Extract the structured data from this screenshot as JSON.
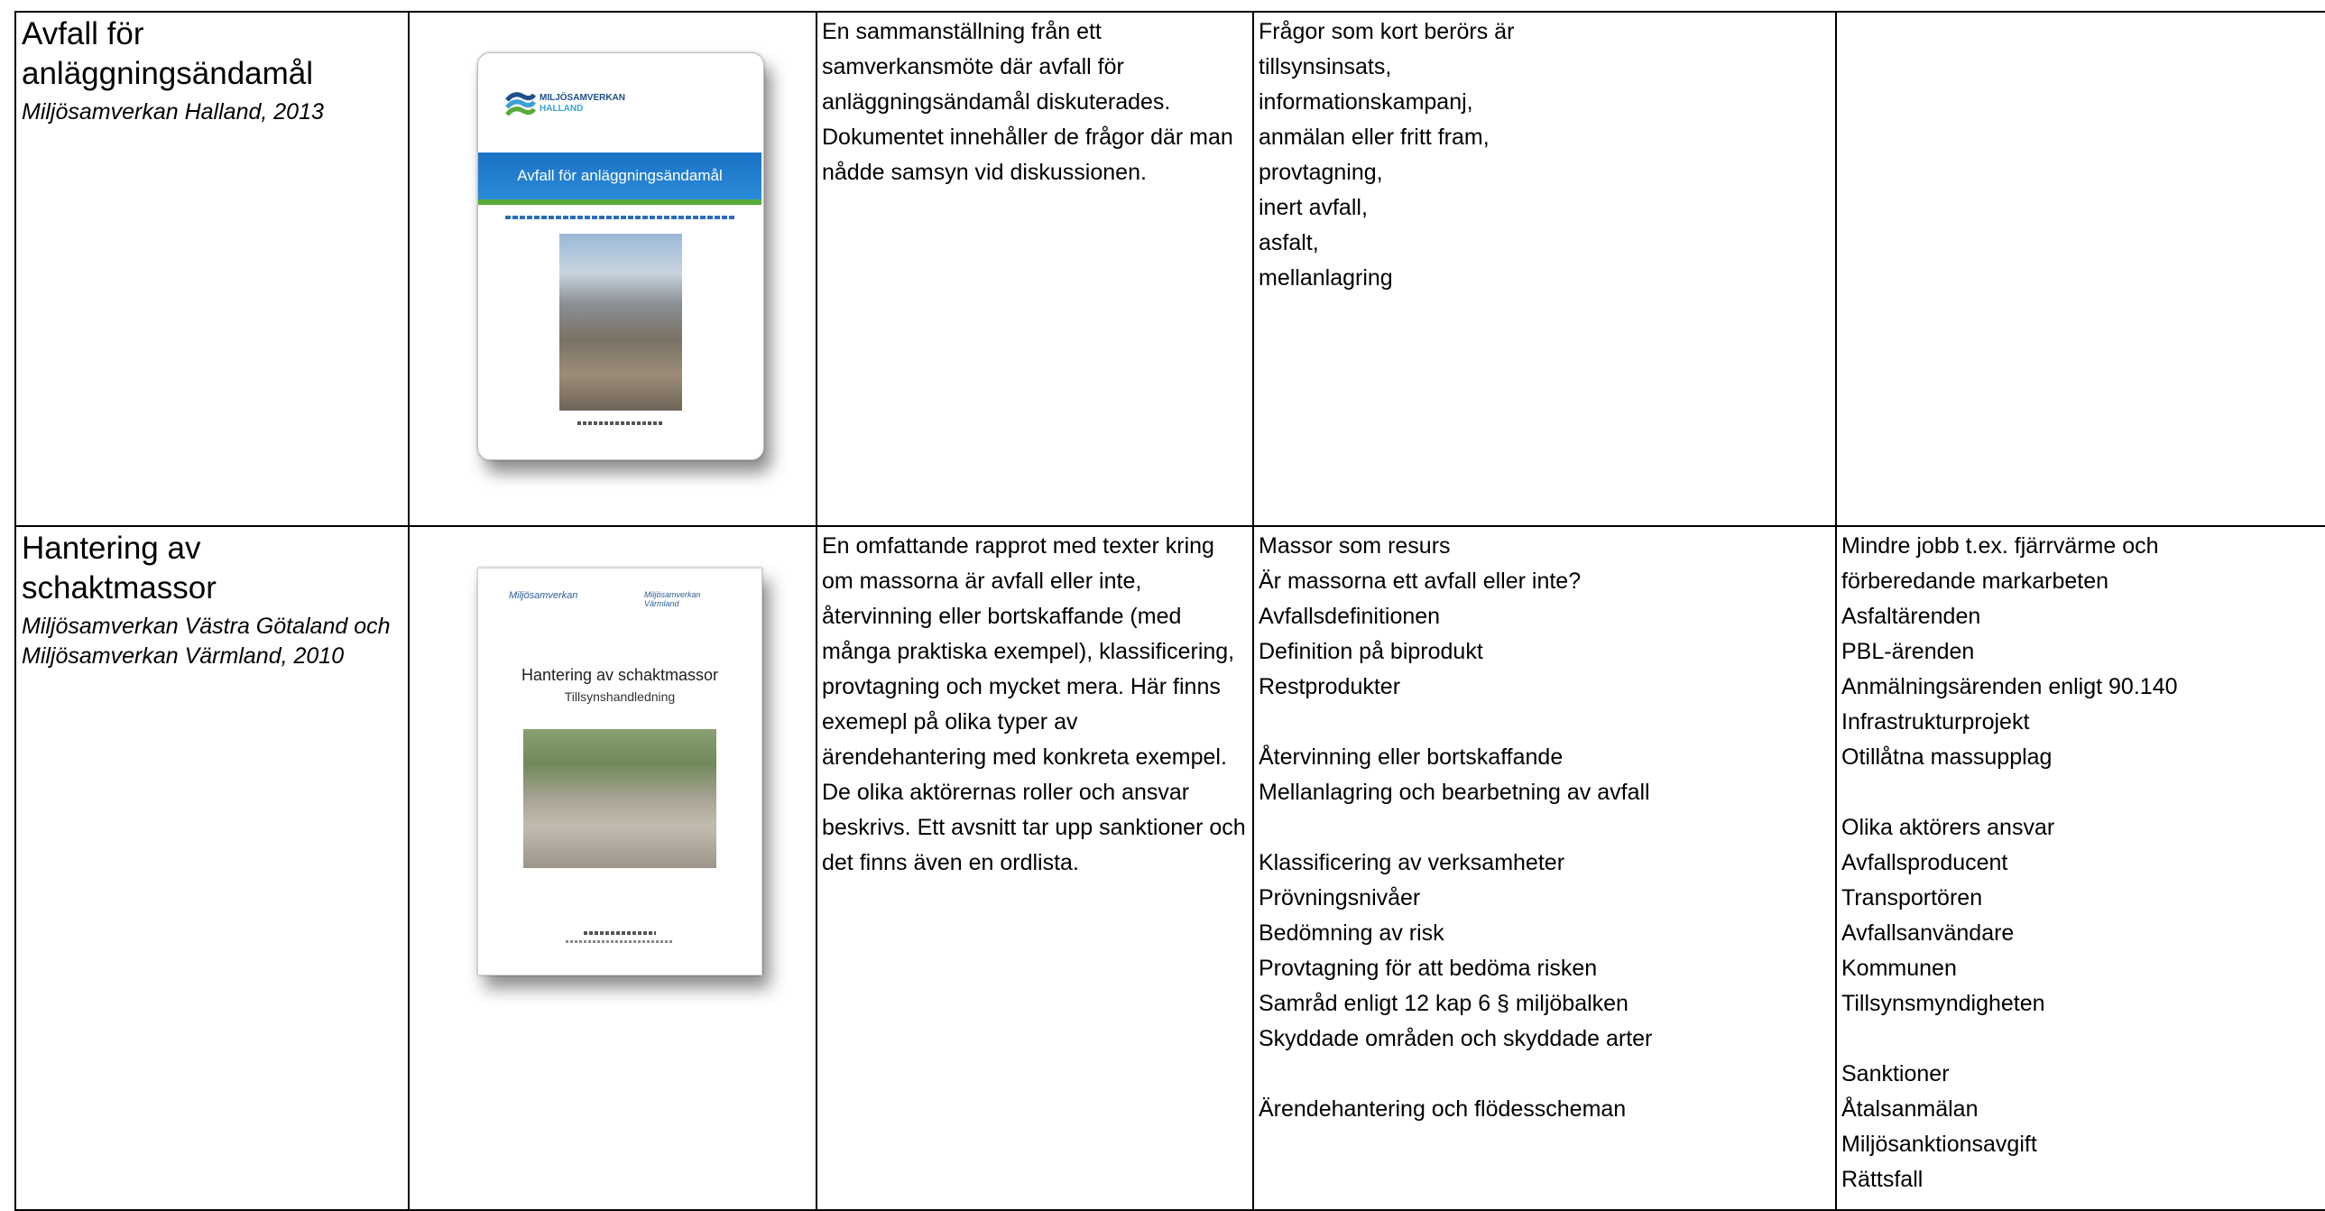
{
  "rows": [
    {
      "title": "Avfall för anläggningsändamål",
      "source": "Miljösamverkan Halland, 2013",
      "cover": {
        "logo_text": "MILJÖSAMVERKAN",
        "logo_sub": "HALLAND",
        "band_title": "Avfall för anläggningsändamål"
      },
      "description": "En sammanställning från ett samverkansmöte där avfall för anläggningsändamål diskuterades. Dokumentet innehåller de frågor där man nådde samsyn vid diskussionen.",
      "topics": [
        "Frågor som kort berörs är",
        "tillsynsinsats,",
        "informationskampanj,",
        "anmälan eller fritt fram,",
        "provtagning,",
        "inert avfall,",
        "asfalt,",
        "mellanlagring"
      ],
      "extra": []
    },
    {
      "title": "Hantering av schaktmassor",
      "source": "Miljösamverkan Västra Götaland och Miljösamverkan Värmland, 2010",
      "cover": {
        "logo_left": "Miljösamverkan",
        "logo_right": "Miljösamverkan Värmland",
        "title": "Hantering av schaktmassor",
        "subtitle": "Tillsynshandledning"
      },
      "description": "En omfattande rapprot med texter kring  om massorna är avfall eller inte, återvinning eller bortskaffande (med många praktiska exempel), klassificering, provtagning och mycket mera. Här finns exemepl på olika typer av ärendehantering med konkreta exempel. De olika aktörernas roller och ansvar beskrivs. Ett avsnitt tar upp sanktioner och det finns även en ordlista.",
      "topics": [
        "Massor som resurs",
        "Är massorna ett avfall eller inte?",
        "Avfallsdefinitionen",
        "Definition på biprodukt",
        "Restprodukter",
        "",
        "Återvinning eller bortskaffande",
        "Mellanlagring och bearbetning av avfall",
        "",
        "Klassificering av verksamheter",
        "Prövningsnivåer",
        "Bedömning av risk",
        "Provtagning för att bedöma risken",
        "Samråd enligt 12 kap 6 § miljöbalken",
        "Skyddade områden och skyddade arter",
        "",
        "Ärendehantering och flödesscheman"
      ],
      "extra": [
        "Mindre jobb t.ex. fjärrvärme och",
        "förberedande markarbeten",
        "Asfaltärenden",
        "PBL-ärenden",
        "Anmälningsärenden enligt 90.140",
        "Infrastrukturprojekt",
        "Otillåtna massupplag",
        "",
        "Olika aktörers ansvar",
        "Avfallsproducent",
        "Transportören",
        "Avfallsanvändare",
        "Kommunen",
        "Tillsynsmyndigheten",
        "",
        "Sanktioner",
        "Åtalsanmälan",
        "Miljösanktionsavgift",
        "Rättsfall"
      ]
    }
  ]
}
